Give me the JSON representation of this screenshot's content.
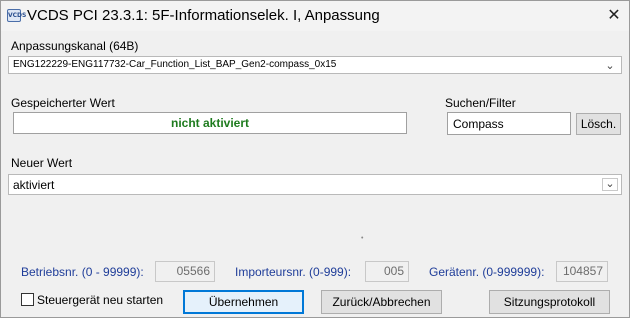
{
  "window": {
    "title": "VCDS PCI 23.3.1: 5F-Informationselek. I,  Anpassung",
    "icon_label": "VCDS",
    "close_glyph": "✕"
  },
  "channel": {
    "label": "Anpassungskanal (64B)",
    "value": "ENG122229-ENG117732-Car_Function_List_BAP_Gen2-compass_0x15"
  },
  "stored": {
    "label": "Gespeicherter Wert",
    "value": "nicht aktiviert",
    "value_color": "#1e7b1e"
  },
  "search": {
    "label": "Suchen/Filter",
    "value": "Compass",
    "clear_label": "Lösch."
  },
  "new_value": {
    "label": "Neuer Wert",
    "value": "aktiviert"
  },
  "footer": {
    "operating_label": "Betriebsnr. (0 - 99999):",
    "operating_value": "05566",
    "importer_label": "Importeursnr. (0-999):",
    "importer_value": "005",
    "device_label": "Gerätenr. (0-999999):",
    "device_value": "104857",
    "label_color": "#1f3d99"
  },
  "restart": {
    "label": "Steuergerät neu starten",
    "checked": false
  },
  "buttons": {
    "apply": "Übernehmen",
    "back": "Zurück/Abbrechen",
    "log": "Sitzungsprotokoll"
  },
  "icons": {
    "dropdown": "chevron-down-icon",
    "close": "close-icon"
  }
}
